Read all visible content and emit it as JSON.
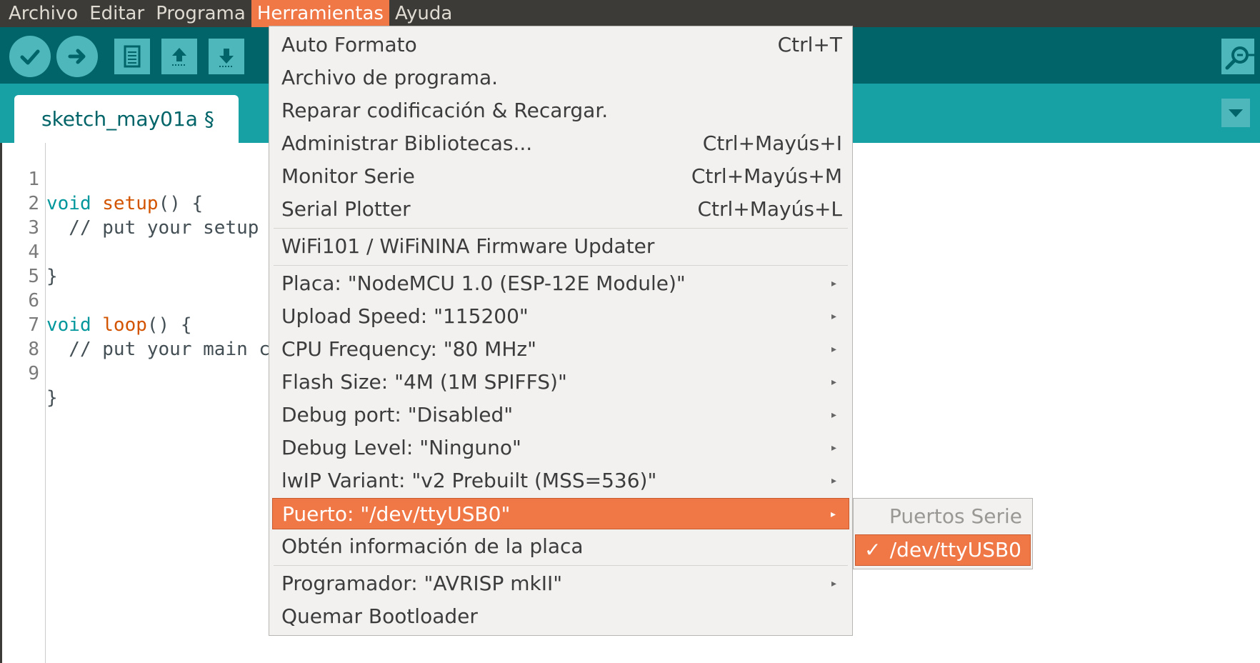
{
  "menubar": {
    "items": [
      {
        "label": "Archivo"
      },
      {
        "label": "Editar"
      },
      {
        "label": "Programa"
      },
      {
        "label": "Herramientas",
        "active": true
      },
      {
        "label": "Ayuda"
      }
    ]
  },
  "toolbar": {
    "buttons": [
      "verify-icon",
      "upload-icon",
      "new-icon",
      "open-icon",
      "save-icon"
    ],
    "serial_monitor_icon": "magnifier-icon"
  },
  "tabs": {
    "active": "sketch_may01a §"
  },
  "editor": {
    "lines": [
      {
        "num": "1",
        "kw": "void",
        "fn": "setup",
        "rest": "() {"
      },
      {
        "num": "2",
        "comment": "  // put your setup "
      },
      {
        "num": "3"
      },
      {
        "num": "4",
        "rest_only": "}"
      },
      {
        "num": "5"
      },
      {
        "num": "6",
        "kw": "void",
        "fn": "loop",
        "rest": "() {"
      },
      {
        "num": "7",
        "comment": "  // put your main c"
      },
      {
        "num": "8"
      },
      {
        "num": "9",
        "rest_only": "}"
      }
    ]
  },
  "tools_menu": {
    "groups": [
      [
        {
          "label": "Auto Formato",
          "shortcut": "Ctrl+T"
        },
        {
          "label": "Archivo de programa."
        },
        {
          "label": "Reparar codificación & Recargar."
        },
        {
          "label": "Administrar Bibliotecas...",
          "shortcut": "Ctrl+Mayús+I"
        },
        {
          "label": "Monitor Serie",
          "shortcut": "Ctrl+Mayús+M"
        },
        {
          "label": "Serial Plotter",
          "shortcut": "Ctrl+Mayús+L"
        }
      ],
      [
        {
          "label": "WiFi101 / WiFiNINA Firmware Updater"
        }
      ],
      [
        {
          "label": "Placa: \"NodeMCU 1.0 (ESP-12E Module)\"",
          "submenu": true
        },
        {
          "label": "Upload Speed: \"115200\"",
          "submenu": true
        },
        {
          "label": "CPU Frequency: \"80 MHz\"",
          "submenu": true
        },
        {
          "label": "Flash Size: \"4M (1M SPIFFS)\"",
          "submenu": true
        },
        {
          "label": "Debug port: \"Disabled\"",
          "submenu": true
        },
        {
          "label": "Debug Level: \"Ninguno\"",
          "submenu": true
        },
        {
          "label": "lwIP Variant: \"v2 Prebuilt (MSS=536)\"",
          "submenu": true
        },
        {
          "label": "Puerto: \"/dev/ttyUSB0\"",
          "submenu": true,
          "highlighted": true
        },
        {
          "label": "Obtén información de la placa"
        }
      ],
      [
        {
          "label": "Programador: \"AVRISP mkII\"",
          "submenu": true
        },
        {
          "label": "Quemar Bootloader"
        }
      ]
    ]
  },
  "port_submenu": {
    "header": "Puertos Serie",
    "items": [
      {
        "label": "/dev/ttyUSB0",
        "checked": true
      }
    ]
  },
  "colors": {
    "menubar_bg": "#3c3b37",
    "toolbar_bg": "#006468",
    "tabsbar_bg": "#17a1a5",
    "button_bg": "#4db7bb",
    "highlight": "#f07746",
    "menu_bg": "#f2f1f0"
  }
}
